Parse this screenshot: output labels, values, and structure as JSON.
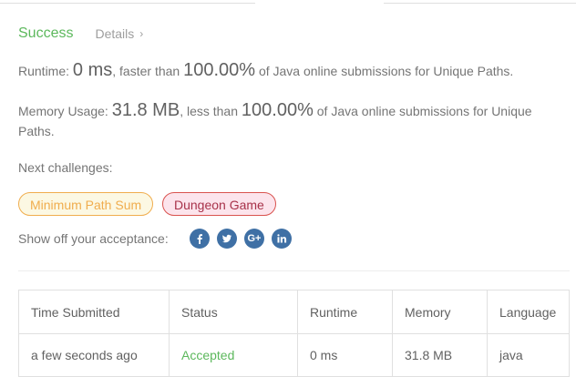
{
  "result": {
    "status": "Success",
    "details_label": "Details"
  },
  "runtime": {
    "label": "Runtime:",
    "value": "0 ms",
    "comparison": ", faster than",
    "percent": "100.00%",
    "suffix": "of Java online submissions for Unique Paths."
  },
  "memory": {
    "label": "Memory Usage:",
    "value": "31.8 MB",
    "comparison": ", less than",
    "percent": "100.00%",
    "suffix": "of Java online submissions for Unique Paths."
  },
  "next": {
    "label": "Next challenges:",
    "challenges": [
      "Minimum Path Sum",
      "Dungeon Game"
    ]
  },
  "share": {
    "label": "Show off your acceptance:",
    "icons": [
      "facebook-icon",
      "twitter-icon",
      "google-plus-icon",
      "linkedin-icon"
    ]
  },
  "submissions": {
    "headers": [
      "Time Submitted",
      "Status",
      "Runtime",
      "Memory",
      "Language"
    ],
    "rows": [
      [
        "a few seconds ago",
        "Accepted",
        "0 ms",
        "31.8 MB",
        "java"
      ]
    ]
  },
  "colors": {
    "success": "#5cb85c",
    "medium": "#f0ad4e",
    "hard": "#d9534f",
    "share": "#3f70a5"
  }
}
